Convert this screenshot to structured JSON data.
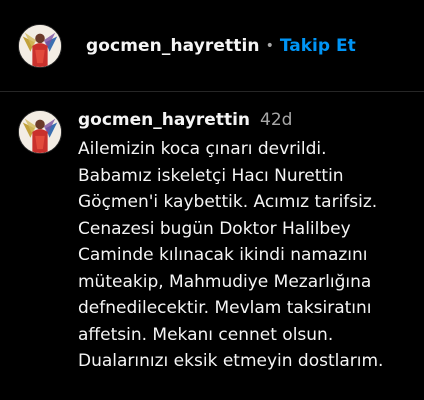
{
  "colors": {
    "background": "#000000",
    "text": "#f5f5f5",
    "secondary": "#a8a8a8",
    "link": "#0095f6",
    "divider": "#262626"
  },
  "header": {
    "avatar_icon": "profile-avatar",
    "username": "gocmen_hayrettin",
    "separator": "•",
    "follow_label": "Takip Et"
  },
  "comment": {
    "avatar_icon": "profile-avatar",
    "username": "gocmen_hayrettin",
    "time": "42d",
    "lines": [
      "Ailemizin koca çınarı devrildi.",
      "Babamız iskeletçi Hacı Nurettin",
      "Göçmen'i kaybettik. Acımız tarifsiz.",
      "Cenazesi bugün Doktor Halilbey",
      "Caminde kılınacak ikindi namazını",
      "müteakip, Mahmudiye Mezarlığına",
      "defnedilecektir. Mevlam taksiratını",
      "affetsin. Mekanı cennet olsun.",
      "Dualarınızı eksik etmeyin dostlarım."
    ]
  }
}
